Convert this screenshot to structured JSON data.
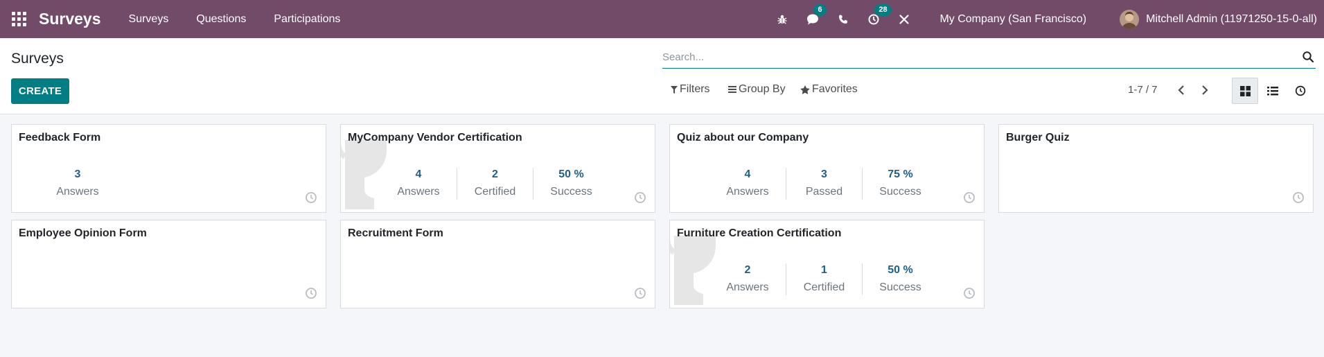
{
  "navbar": {
    "brand": "Surveys",
    "menu": [
      "Surveys",
      "Questions",
      "Participations"
    ],
    "messages_badge": "6",
    "activities_badge": "28",
    "company": "My Company (San Francisco)",
    "user": "Mitchell Admin (11971250-15-0-all)",
    "colors": {
      "bar": "#714b67",
      "badge": "#017e84"
    }
  },
  "control": {
    "title": "Surveys",
    "create_label": "CREATE",
    "search_placeholder": "Search...",
    "filters_label": "Filters",
    "groupby_label": "Group By",
    "favorites_label": "Favorites",
    "pager": "1-7 / 7",
    "views": [
      "kanban-view",
      "list-view",
      "activity-view"
    ],
    "active_view": "kanban-view"
  },
  "cards": [
    {
      "title": "Feedback Form",
      "certification": false,
      "stats": [
        {
          "value": "3",
          "label": "Answers"
        }
      ]
    },
    {
      "title": "MyCompany Vendor Certification",
      "certification": true,
      "stats": [
        {
          "value": "4",
          "label": "Answers"
        },
        {
          "value": "2",
          "label": "Certified"
        },
        {
          "value": "50 %",
          "label": "Success"
        }
      ]
    },
    {
      "title": "Quiz about our Company",
      "certification": false,
      "stats": [
        {
          "value": "4",
          "label": "Answers"
        },
        {
          "value": "3",
          "label": "Passed"
        },
        {
          "value": "75 %",
          "label": "Success"
        }
      ]
    },
    {
      "title": "Burger Quiz",
      "certification": false,
      "stats": []
    },
    {
      "title": "Employee Opinion Form",
      "certification": false,
      "stats": []
    },
    {
      "title": "Recruitment Form",
      "certification": false,
      "stats": []
    },
    {
      "title": "Furniture Creation Certification",
      "certification": true,
      "stats": [
        {
          "value": "2",
          "label": "Answers"
        },
        {
          "value": "1",
          "label": "Certified"
        },
        {
          "value": "50 %",
          "label": "Success"
        }
      ]
    }
  ]
}
